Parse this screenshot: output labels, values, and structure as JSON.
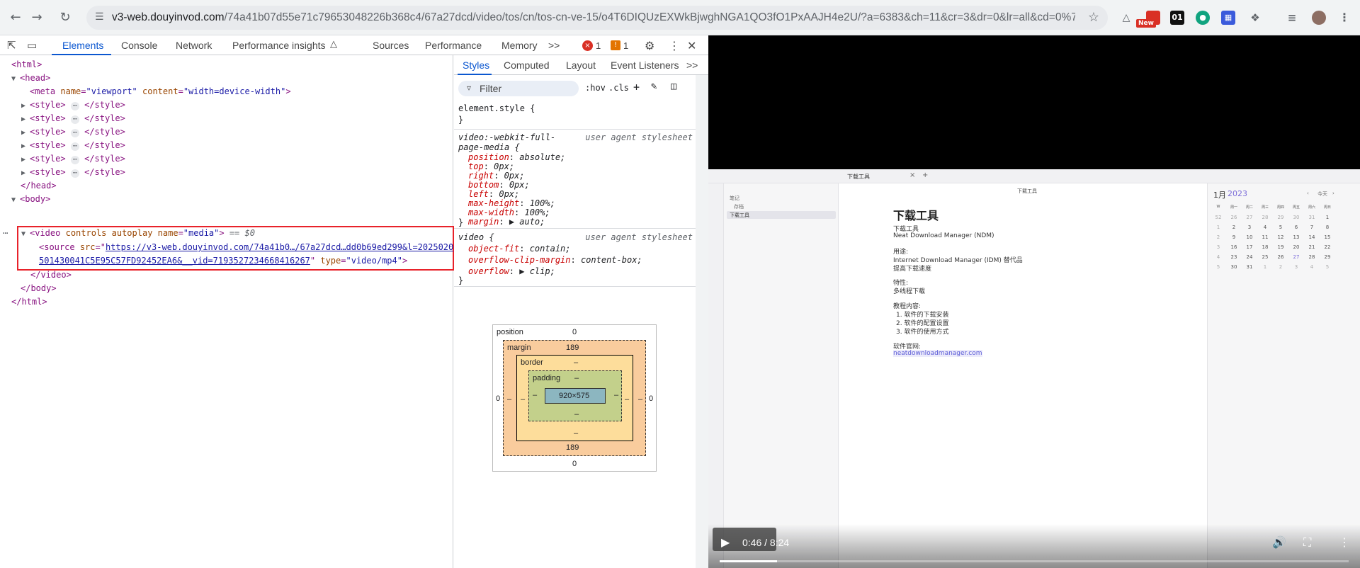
{
  "browser": {
    "url_host": "v3-web.douyinvod.com",
    "url_path": "/74a41b07d55e71c79653048226b368c4/67a27dcd/video/tos/cn/tos-cn-ve-15/o4T6DIQUzEXWkBjwghNGA1QO3fO1PxAAJH4e2U/?a=6383&ch=11&cr=3&dr=0&lr=all&cd=0%7...",
    "ext_badge_new": "New",
    "ext_01": "01"
  },
  "devtools": {
    "tabs": [
      "Elements",
      "Console",
      "Network",
      "Performance insights",
      "Sources",
      "Performance",
      "Memory"
    ],
    "more": ">>",
    "errors": "1",
    "warnings": "1",
    "styles_tabs": [
      "Styles",
      "Computed",
      "Layout",
      "Event Listeners"
    ],
    "filter_placeholder": "Filter",
    "hov": ":hov",
    "cls": ".cls",
    "dom": {
      "html_open": "<html>",
      "head_open": "<head>",
      "meta_tag": "meta",
      "meta_a1": "name",
      "meta_v1": "\"viewport\"",
      "meta_a2": "content",
      "meta_v2": "\"width=device-width\"",
      "style_open": "<style>",
      "style_close": "</style>",
      "head_close": "</head>",
      "body_open": "<body>",
      "video_tag": "video",
      "video_attrs": "controls autoplay",
      "video_a_name": "name",
      "video_v_name": "\"media\"",
      "selected_marker": "== $0",
      "source_tag": "source",
      "source_a_src": "src",
      "source_url_1": "https://v3-web.douyinvod.com/74a41b0…/67a27dcd…dd0b69ed299&l=2025020",
      "source_url_2": "501430041C5E95C57FD92452EA6&__vid=7193527234668416267",
      "source_a_type": "type",
      "source_v_type": "\"video/mp4\"",
      "video_close": "</video>",
      "body_close": "</body>",
      "html_close": "</html>"
    },
    "rules": {
      "element_style": "element.style {",
      "close_brace": "}",
      "rule1_selector_1": "video:-webkit-full-",
      "rule1_selector_2": "page-media {",
      "user_agent": "user agent stylesheet",
      "rule1_props": [
        {
          "p": "position",
          "v": "absolute;"
        },
        {
          "p": "top",
          "v": "0px;"
        },
        {
          "p": "right",
          "v": "0px;"
        },
        {
          "p": "bottom",
          "v": "0px;"
        },
        {
          "p": "left",
          "v": "0px;"
        },
        {
          "p": "max-height",
          "v": "100%;"
        },
        {
          "p": "max-width",
          "v": "100%;"
        },
        {
          "p": "margin",
          "v": "▶ auto;"
        }
      ],
      "rule2_selector": "video {",
      "rule2_props": [
        {
          "p": "object-fit",
          "v": "contain;"
        },
        {
          "p": "overflow-clip-margin",
          "v": "content-box;"
        },
        {
          "p": "overflow",
          "v": "▶ clip;"
        }
      ]
    },
    "box_model": {
      "position_label": "position",
      "position_top": "0",
      "position_left": "0",
      "position_right": "0",
      "position_bottom": "0",
      "margin_label": "margin",
      "margin_top": "189",
      "margin_bottom": "189",
      "margin_left": "0",
      "margin_right": "0",
      "border_label": "border",
      "dash": "–",
      "padding_label": "padding",
      "content_size": "920×575"
    }
  },
  "video": {
    "current_time": "0:46",
    "duration": "8:24",
    "time_sep": " / ",
    "progress_fraction": 0.091,
    "note": {
      "tab_title": "下载工具",
      "header_title": "下载工具",
      "tree_root": "笔记",
      "tree_folder": "存档",
      "tree_selected": "下载工具",
      "h1": "下载工具",
      "lines": [
        "下载工具",
        "Neat Download Manager (NDM)",
        "用途:",
        "Internet Download Manager (IDM) 替代品",
        "提高下载速度",
        "特性:",
        "多线程下载",
        "教程内容:",
        "1. 软件的下载安装",
        "2. 软件的配置设置",
        "3. 软件的使用方式",
        "软件官网:",
        "neatdownloadmanager.com"
      ],
      "cal_month": "1月",
      "cal_year": "2023",
      "cal_today": "今天",
      "cal_weekdays": [
        "W",
        "周一",
        "周二",
        "周三",
        "周四",
        "周五",
        "周六",
        "周日"
      ],
      "cal_rows": [
        [
          "52",
          "26",
          "27",
          "28",
          "29",
          "30",
          "31",
          "1"
        ],
        [
          "1",
          "2",
          "3",
          "4",
          "5",
          "6",
          "7",
          "8"
        ],
        [
          "2",
          "9",
          "10",
          "11",
          "12",
          "13",
          "14",
          "15"
        ],
        [
          "3",
          "16",
          "17",
          "18",
          "19",
          "20",
          "21",
          "22"
        ],
        [
          "4",
          "23",
          "24",
          "25",
          "26",
          "27",
          "28",
          "29"
        ],
        [
          "5",
          "30",
          "31",
          "1",
          "2",
          "3",
          "4",
          "5"
        ]
      ]
    }
  }
}
